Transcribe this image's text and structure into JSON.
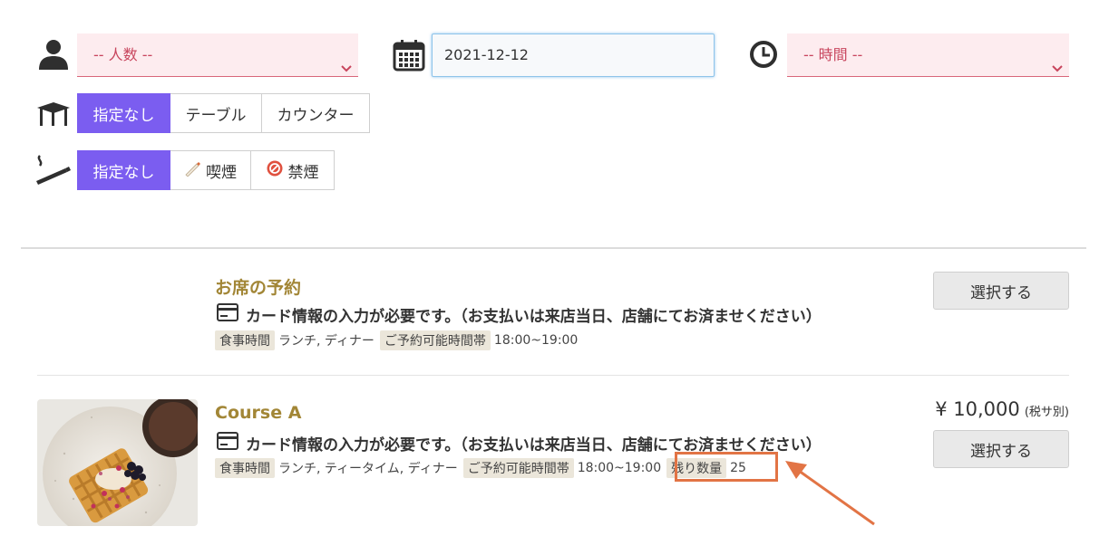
{
  "filters": {
    "people_placeholder": "-- 人数 --",
    "date_value": "2021-12-12",
    "time_placeholder": "-- 時間 --",
    "seat_options": [
      "指定なし",
      "テーブル",
      "カウンター"
    ],
    "smoking_options": [
      "指定なし",
      "喫煙",
      "禁煙"
    ]
  },
  "plans": [
    {
      "title": "お席の予約",
      "note": "カード情報の入力が必要です。（お支払いは来店当日、店舗にてお済ませください）",
      "meal_time_label": "食事時間",
      "meal_time_value": "ランチ, ディナー",
      "reservation_time_label": "ご予約可能時間帯",
      "reservation_time_value": "18:00~19:00",
      "select_label": "選択する"
    },
    {
      "title": "Course A",
      "note": "カード情報の入力が必要です。（お支払いは来店当日、店舗にてお済ませください）",
      "meal_time_label": "食事時間",
      "meal_time_value": "ランチ, ティータイム, ディナー",
      "reservation_time_label": "ご予約可能時間帯",
      "reservation_time_value": "18:00~19:00",
      "remaining_label": "残り数量",
      "remaining_value": "25",
      "price": "¥ 10,000",
      "price_note": "(税サ別)",
      "select_label": "選択する"
    }
  ],
  "colors": {
    "accent": "#7b5df0",
    "title_gold": "#a28636",
    "select_text": "#c8455d",
    "highlight": "#e27445"
  }
}
